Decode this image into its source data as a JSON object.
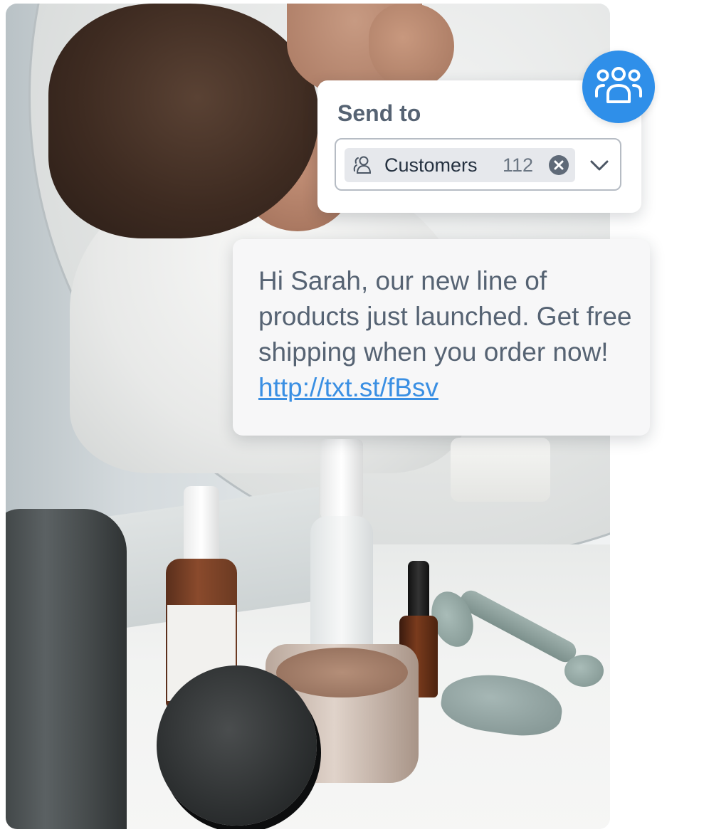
{
  "send_to": {
    "title": "Send to",
    "recipient_chip": {
      "label": "Customers",
      "count": "112",
      "icon": "contacts-group-icon",
      "remove_icon": "close-circle-icon"
    },
    "dropdown_icon": "chevron-down-icon"
  },
  "group_badge": {
    "icon": "group-people-icon",
    "color": "#2f8fe9"
  },
  "message": {
    "text": "Hi Sarah, our new line of products just launched. Get free shipping when you order now! ",
    "link": "http://txt.st/fBsv",
    "link_color": "#3a8fe3"
  },
  "photo": {
    "description_icon": "beauty-products-photo"
  }
}
